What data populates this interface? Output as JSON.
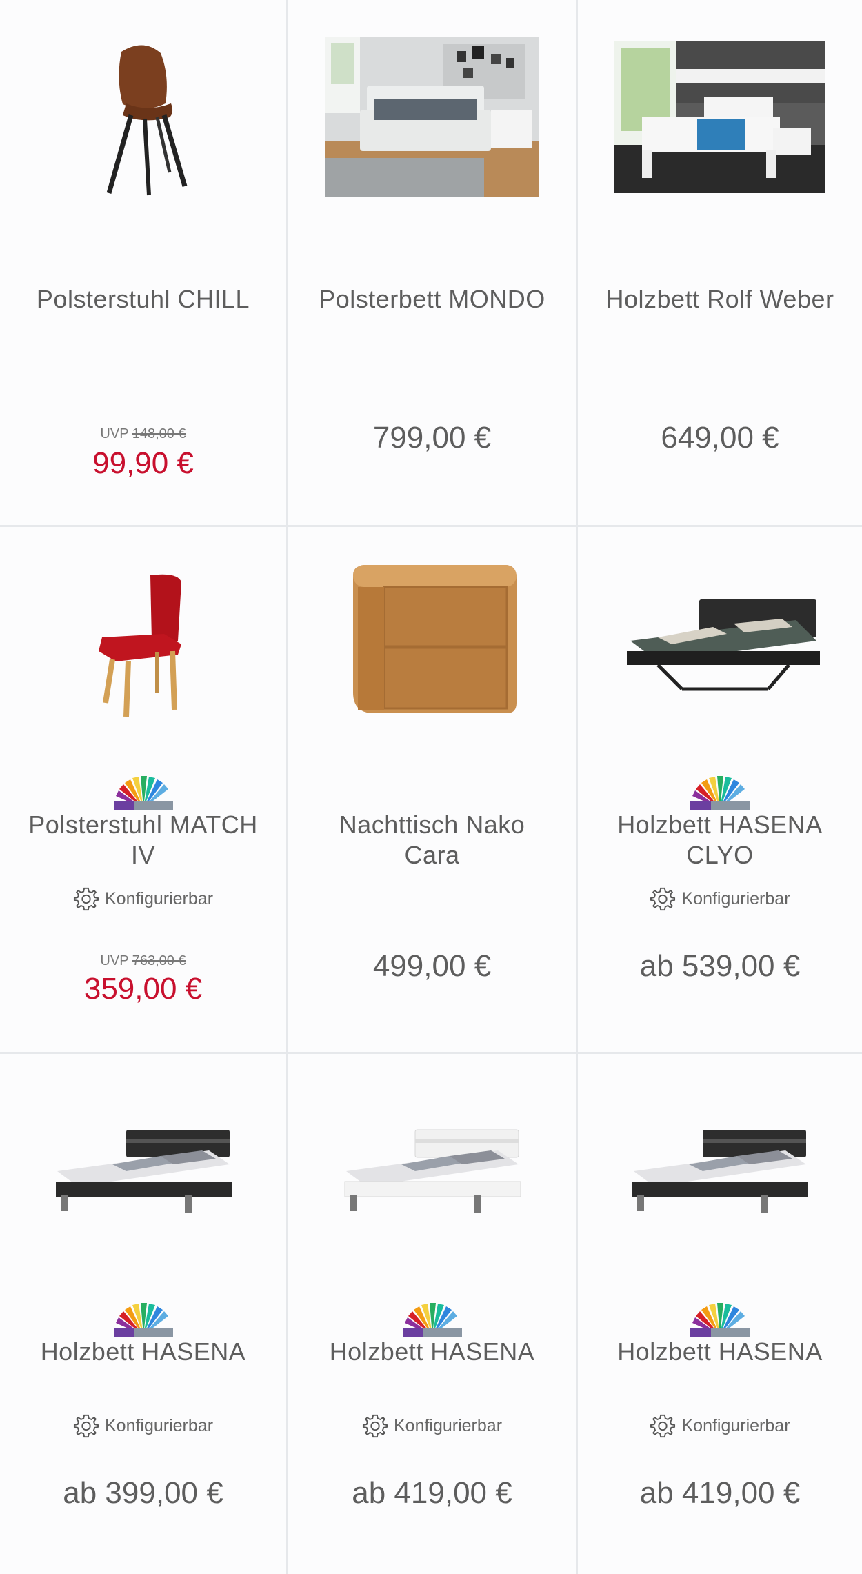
{
  "products": [
    {
      "title": "Polsterstuhl CHILL",
      "uvp_label": "UVP",
      "uvp_price": "148,00 €",
      "price": "99,90 €",
      "image": "brown-chair"
    },
    {
      "title": "Polsterbett MONDO",
      "price": "799,00 €",
      "image": "bedroom-photo"
    },
    {
      "title": "Holzbett Rolf Weber",
      "price": "649,00 €",
      "image": "white-bed-photo"
    },
    {
      "title": "Polsterstuhl MATCH IV",
      "configurable": "Konfigurierbar",
      "uvp_label": "UVP",
      "uvp_price": "763,00 €",
      "price": "359,00 €",
      "image": "red-chair",
      "swatch": "color-fan-icon"
    },
    {
      "title": "Nachttisch Nako Cara",
      "price": "499,00 €",
      "image": "wood-nightstand"
    },
    {
      "title": "Holzbett HASENA CLYO",
      "configurable": "Konfigurierbar",
      "price": "ab 539,00 €",
      "image": "black-bed",
      "swatch": "color-fan-icon"
    },
    {
      "title": "Holzbett HASENA",
      "configurable": "Konfigurierbar",
      "price": "ab 399,00 €",
      "image": "black-bed-low",
      "swatch": "color-fan-icon"
    },
    {
      "title": "Holzbett HASENA",
      "configurable": "Konfigurierbar",
      "price": "ab 419,00 €",
      "image": "white-bed-low",
      "swatch": "color-fan-icon"
    },
    {
      "title": "Holzbett HASENA",
      "configurable": "Konfigurierbar",
      "price": "ab 419,00 €",
      "image": "black-bed-low",
      "swatch": "color-fan-icon"
    }
  ],
  "colors": {
    "sale_red": "#c8102e",
    "text_gray": "#5d5d5d",
    "divider": "#e6e8eb"
  }
}
